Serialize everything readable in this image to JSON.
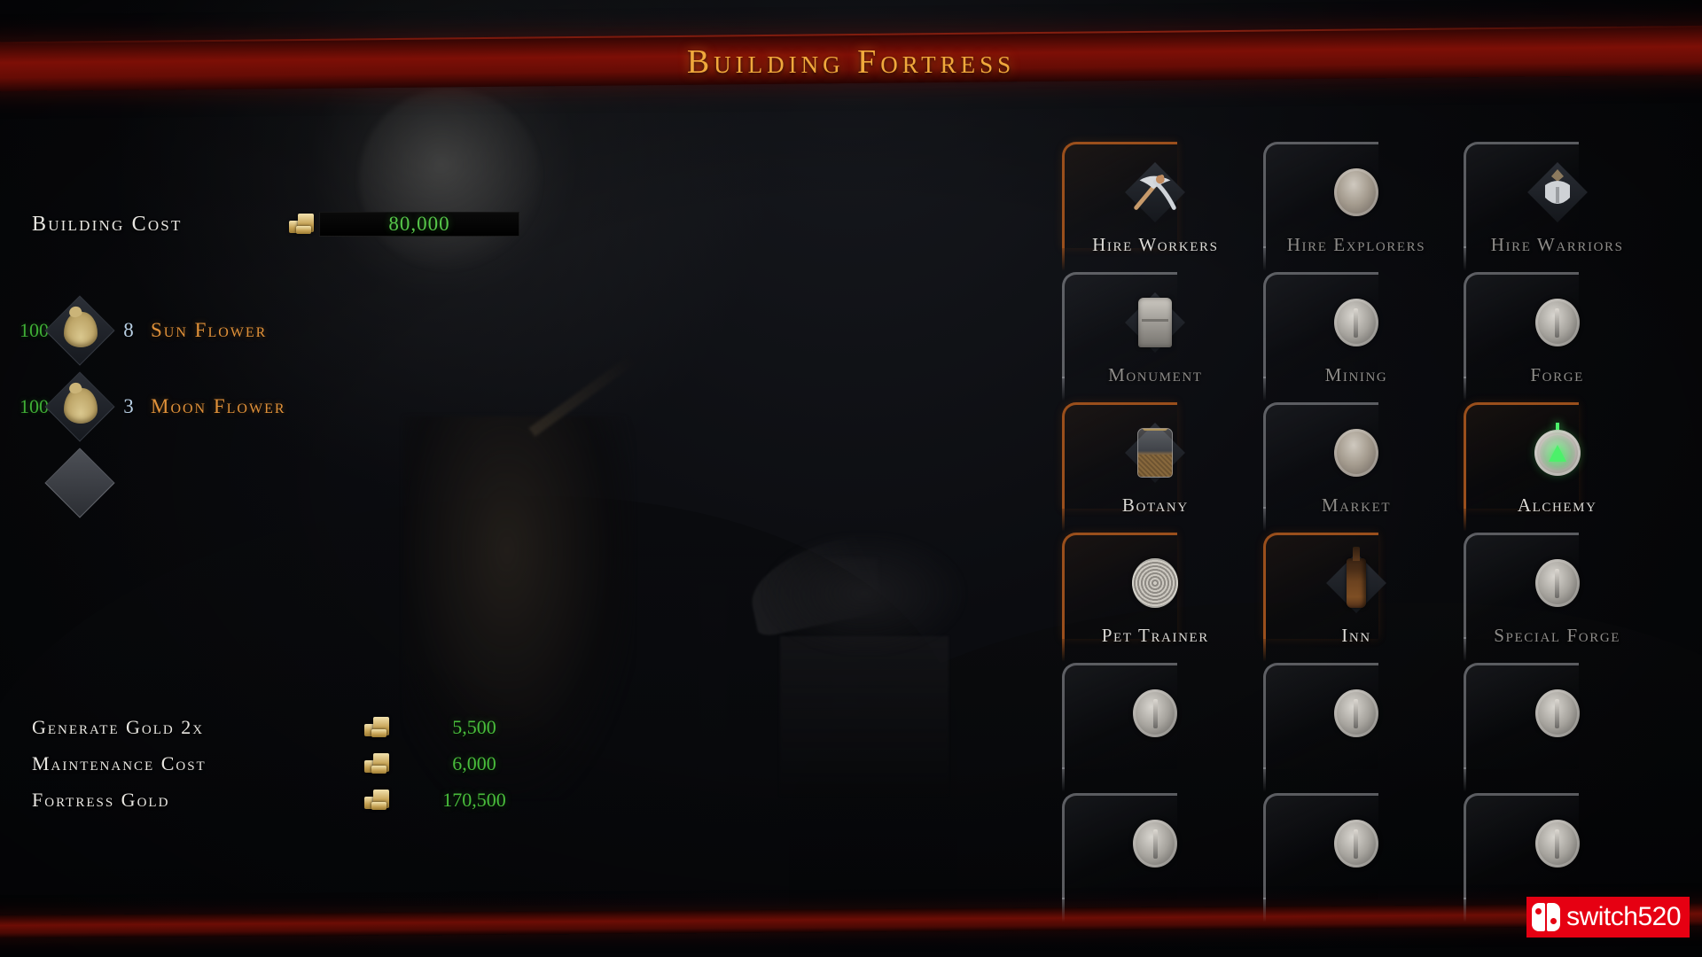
{
  "header": {
    "title": "Building Fortress"
  },
  "left_panel": {
    "building_cost": {
      "label": "Building Cost",
      "value": "80,000",
      "currency_icon": "gold-coin-icon"
    },
    "resources": [
      {
        "owned": "100",
        "required": "8",
        "name": "Sun Flower",
        "icon": "resource-sack-icon"
      },
      {
        "owned": "100",
        "required": "3",
        "name": "Moon Flower",
        "icon": "resource-sack-icon"
      }
    ],
    "empty_slot": {
      "icon": "empty-diamond-slot-icon"
    },
    "stats": [
      {
        "label": "Generate Gold 2x",
        "value": "5,500",
        "icon": "gold-coin-icon"
      },
      {
        "label": "Maintenance Cost",
        "value": "6,000",
        "icon": "gold-coin-icon"
      },
      {
        "label": "Fortress Gold",
        "value": "170,500",
        "icon": "gold-coin-icon"
      }
    ]
  },
  "buildings": [
    {
      "label": "Hire Workers",
      "icon": "pickaxe-icon",
      "state": "active",
      "locked": false
    },
    {
      "label": "Hire Explorers",
      "icon": "stone-coin-icon",
      "state": "inactive",
      "locked": false
    },
    {
      "label": "Hire Warriors",
      "icon": "warrior-helm-icon",
      "state": "inactive",
      "locked": false
    },
    {
      "label": "Monument",
      "icon": "monument-icon",
      "state": "inactive",
      "locked": false
    },
    {
      "label": "Mining",
      "icon": "silver-coin-icon",
      "state": "inactive",
      "locked": false
    },
    {
      "label": "Forge",
      "icon": "silver-coin-icon",
      "state": "inactive",
      "locked": false
    },
    {
      "label": "Botany",
      "icon": "seed-jar-icon",
      "state": "active",
      "locked": false
    },
    {
      "label": "Market",
      "icon": "stone-coin-icon",
      "state": "inactive",
      "locked": false
    },
    {
      "label": "Alchemy",
      "icon": "alchemy-flask-icon",
      "state": "active",
      "locked": false
    },
    {
      "label": "Pet Trainer",
      "icon": "spiral-coin-icon",
      "state": "active",
      "locked": false
    },
    {
      "label": "Inn",
      "icon": "bottle-icon",
      "state": "active",
      "locked": false
    },
    {
      "label": "Special Forge",
      "icon": "silver-coin-icon",
      "state": "inactive",
      "locked": false
    },
    {
      "label": "",
      "icon": "silver-coin-icon",
      "state": "inactive",
      "locked": true
    },
    {
      "label": "",
      "icon": "silver-coin-icon",
      "state": "inactive",
      "locked": true
    },
    {
      "label": "",
      "icon": "silver-coin-icon",
      "state": "inactive",
      "locked": true
    },
    {
      "label": "",
      "icon": "silver-coin-icon",
      "state": "inactive",
      "locked": true
    },
    {
      "label": "",
      "icon": "silver-coin-icon",
      "state": "inactive",
      "locked": true
    },
    {
      "label": "",
      "icon": "silver-coin-icon",
      "state": "inactive",
      "locked": true
    }
  ],
  "watermark": {
    "text": "switch520",
    "icon": "nintendo-switch-logo"
  },
  "colors": {
    "title_gold": "#f0a93c",
    "banner_red": "#7d0f06",
    "value_green": "#57c74a",
    "resource_name_orange": "#e0913a",
    "required_blue": "#b8cfe4",
    "active_border": "#9a4f1c",
    "watermark_red": "#e60012"
  }
}
